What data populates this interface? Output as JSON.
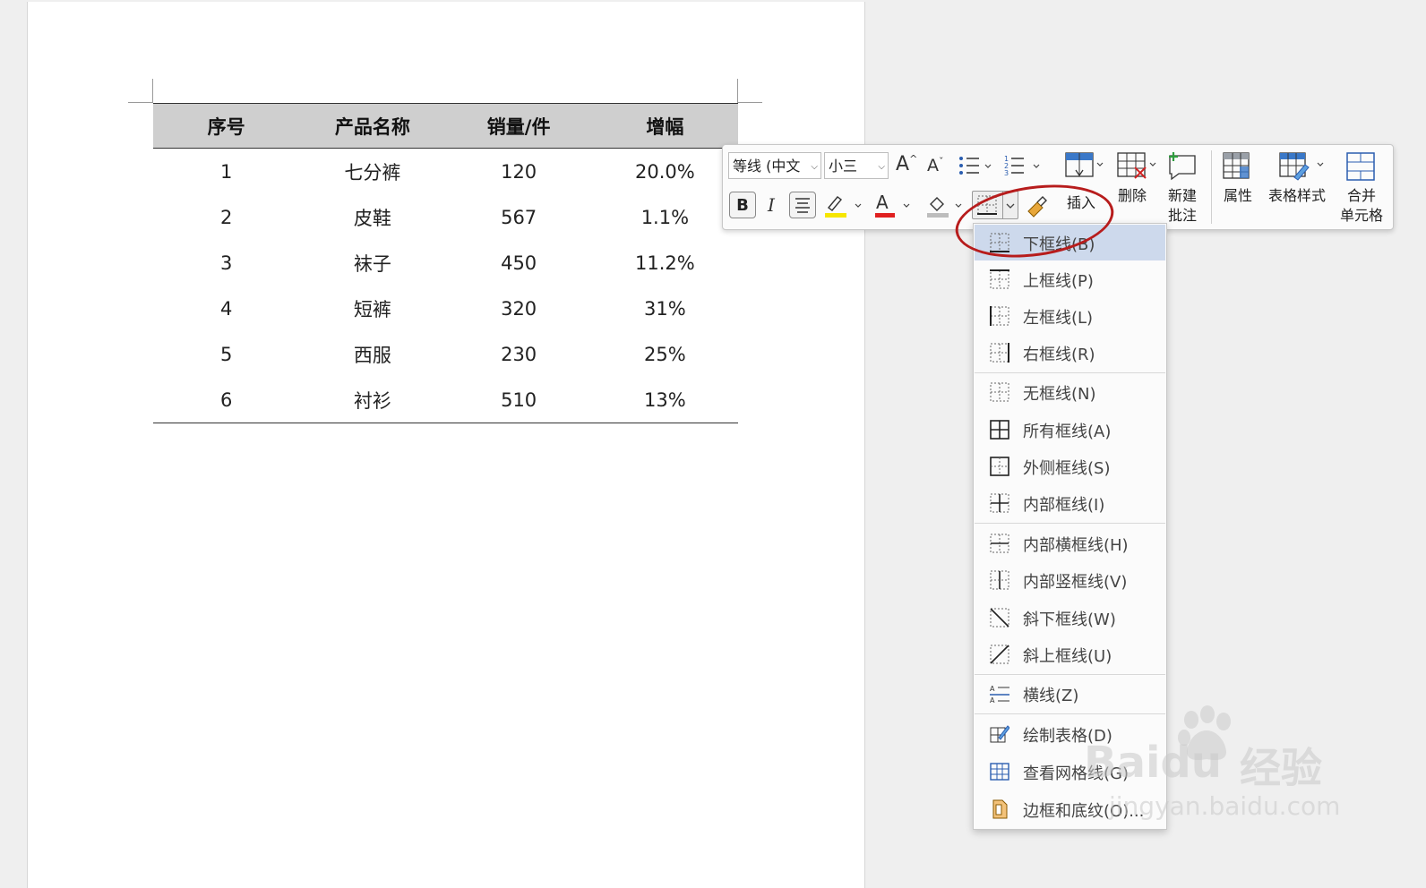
{
  "table": {
    "headers": [
      "序号",
      "产品名称",
      "销量/件",
      "增幅"
    ],
    "rows": [
      [
        "1",
        "七分裤",
        "120",
        "20.0%"
      ],
      [
        "2",
        "皮鞋",
        "567",
        "1.1%"
      ],
      [
        "3",
        "袜子",
        "450",
        "11.2%"
      ],
      [
        "4",
        "短裤",
        "320",
        "31%"
      ],
      [
        "5",
        "西服",
        "230",
        "25%"
      ],
      [
        "6",
        "衬衫",
        "510",
        "13%"
      ]
    ]
  },
  "toolbar": {
    "font_name": "等线 (中文",
    "font_size": "小三",
    "grow_font": "A",
    "shrink_font": "A",
    "bold": "B",
    "italic": "I",
    "font_color_letter": "A",
    "insert_label": "插入",
    "delete_label": "删除",
    "new_comment_line1": "新建",
    "new_comment_line2": "批注",
    "properties_label": "属性",
    "table_styles_label": "表格样式",
    "merge_line1": "合并",
    "merge_line2": "单元格",
    "highlight_color": "#f6e600",
    "font_color": "#e02020"
  },
  "border_menu": {
    "items": [
      {
        "label": "下框线(B)",
        "icon": "bottom-border-icon"
      },
      {
        "label": "上框线(P)",
        "icon": "top-border-icon"
      },
      {
        "label": "左框线(L)",
        "icon": "left-border-icon"
      },
      {
        "label": "右框线(R)",
        "icon": "right-border-icon"
      },
      {
        "label": "无框线(N)",
        "icon": "no-border-icon"
      },
      {
        "label": "所有框线(A)",
        "icon": "all-borders-icon"
      },
      {
        "label": "外侧框线(S)",
        "icon": "outside-borders-icon"
      },
      {
        "label": "内部框线(I)",
        "icon": "inside-borders-icon"
      },
      {
        "label": "内部横框线(H)",
        "icon": "inside-horizontal-border-icon"
      },
      {
        "label": "内部竖框线(V)",
        "icon": "inside-vertical-border-icon"
      },
      {
        "label": "斜下框线(W)",
        "icon": "diagonal-down-border-icon"
      },
      {
        "label": "斜上框线(U)",
        "icon": "diagonal-up-border-icon"
      },
      {
        "label": "横线(Z)",
        "icon": "horizontal-line-icon"
      },
      {
        "label": "绘制表格(D)",
        "icon": "draw-table-icon"
      },
      {
        "label": "查看网格线(G)",
        "icon": "view-gridlines-icon"
      },
      {
        "label": "边框和底纹(O)...",
        "icon": "borders-shading-icon"
      }
    ]
  },
  "watermark": {
    "brand": "Baidu",
    "suffix": "经验",
    "url": "jingyan.baidu.com"
  },
  "colors": {
    "annotation_circle": "#b71c1c",
    "menu_highlight": "#cdd9ec"
  }
}
